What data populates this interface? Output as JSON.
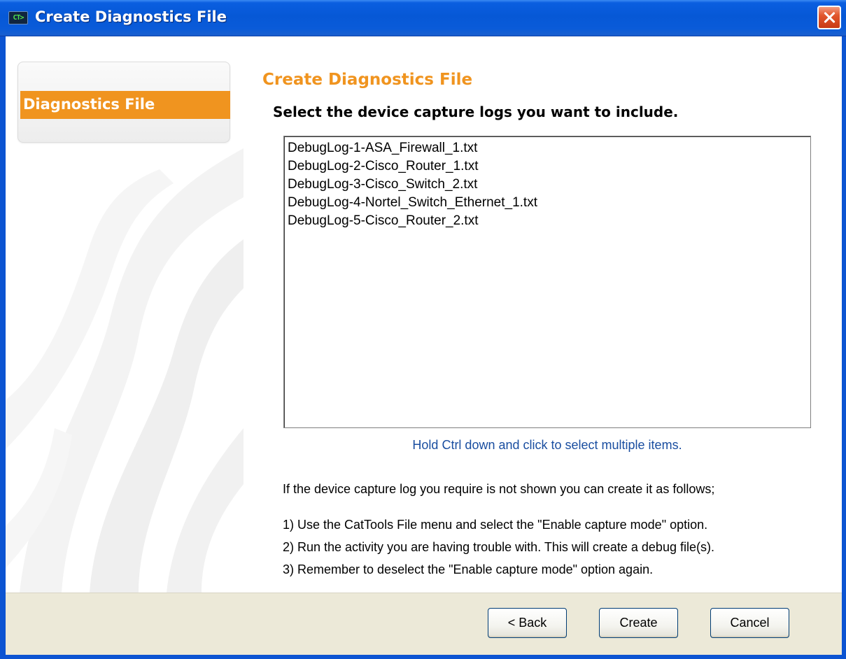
{
  "window": {
    "title": "Create Diagnostics File",
    "app_icon_text": "CT>"
  },
  "sidebar": {
    "items": [
      {
        "label": "Diagnostics File",
        "selected": true
      }
    ]
  },
  "main": {
    "title": "Create Diagnostics File",
    "subtitle": "Select the device capture logs you want to include.",
    "log_files": [
      "DebugLog-1-ASA_Firewall_1.txt",
      "DebugLog-2-Cisco_Router_1.txt",
      "DebugLog-3-Cisco_Switch_2.txt",
      "DebugLog-4-Nortel_Switch_Ethernet_1.txt",
      "DebugLog-5-Cisco_Router_2.txt"
    ],
    "hint": "Hold Ctrl down and click to select multiple items.",
    "info_intro": "If the device capture log you require is not shown you can create it as follows;",
    "steps": [
      "1)  Use the CatTools File menu and select the \"Enable capture mode\" option.",
      "2)  Run the activity you are having trouble with. This will create a debug file(s).",
      "3)  Remember to deselect the \"Enable capture mode\" option again."
    ]
  },
  "buttons": {
    "back": "< Back",
    "create": "Create",
    "cancel": "Cancel"
  },
  "colors": {
    "titlebar": "#0658d6",
    "accent_orange": "#f0941f",
    "hint_blue": "#1a4ea0",
    "button_bar": "#ece9d8"
  }
}
